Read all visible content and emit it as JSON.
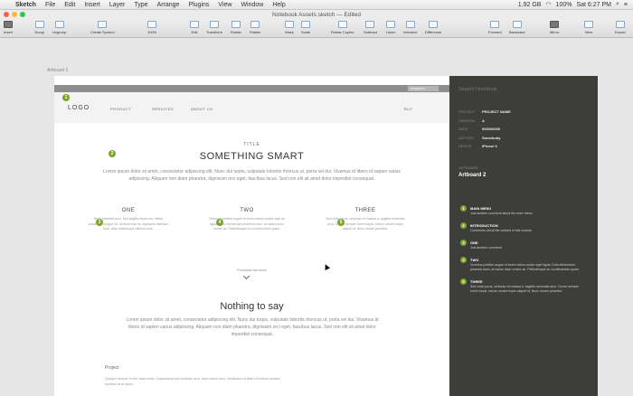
{
  "menubar": {
    "app": "Sketch",
    "items": [
      "File",
      "Edit",
      "Insert",
      "Layer",
      "Type",
      "Arrange",
      "Plugins",
      "View",
      "Window",
      "Help"
    ],
    "disk": "1.92 GB",
    "battery": "100%",
    "clock": "Sat 6:27 PM"
  },
  "window": {
    "title": "Notebook Assets.sketch — Edited"
  },
  "toolbar": {
    "insert": "Insert",
    "group": "Group",
    "ungroup": "Ungroup",
    "create_symbol": "Create Symbol",
    "zoom": "100%",
    "edit": "Edit",
    "transform": "Transform",
    "rotate": "Rotate",
    "flatten": "Flatten",
    "mask": "Mask",
    "scale": "Scale",
    "rotate_copies": "Rotate Copies",
    "subtract": "Subtract",
    "union": "Union",
    "intersect": "Intersect",
    "difference": "Difference",
    "forward": "Forward",
    "backward": "Backward",
    "mirror": "Mirror",
    "view": "View",
    "export": "Export"
  },
  "canvas": {
    "artboard_label": "Artboard 2"
  },
  "artboard": {
    "lang": "english ▾",
    "logo": "LOGO",
    "nav": [
      "PRODUCT",
      "SERVICES",
      "ABOUT US"
    ],
    "buy": "BUY",
    "small_title": "TITLE",
    "hero": "SOMETHING SMART",
    "hero_text": "Lorem ipsum dolor sit amet, consectetur adipiscing elit. Nunc dui turpis, vulputate lobortis rhoncus ut, porta vel dui. Vivamus id libero id sapien varius adipiscing. Aliquam non diam pharetra, dignissim orci eget, faucibus lacus. Sed non elit sit amet dolor imperdiet consequat.",
    "columns": [
      {
        "title": "ONE",
        "text": "Nulla pharetra arcu. Sed sagittis lectus eu, metus solicitudin congue sit. Aenean erat mi, dignissim interdum fiyal, vitae scelerisque efficitur eros."
      },
      {
        "title": "TWO",
        "text": "Vivamus porttitor augue et lorem varius auctor eget ac ligula. Duis elementum pharetra dolor, at varius dolor ornare ac. Pellentesque eu condimentum quam."
      },
      {
        "title": "THREE",
        "text": "Sed nulla purus, vehicula vel massa a, sagittis venenatis arcu. Donec semper lorem turpis, rutrum ornare turpis aliquet id. Nunc ornare pharetra."
      }
    ],
    "more": "Products/ services",
    "h2": "Nothing to say",
    "text2": "Lorem ipsum dolor sit amet, consectetur adipiscing elit. Nunc dui turpis, vulputate lobortis rhoncus ut, porta vel dui. Vivamus id libero id sapien varius adipiscing. Aliquam non diam pharetra, dignissim orci eget, faucibus lacus. Sed non elit sit amet dolor imperdiet consequat.",
    "project_title": "Project",
    "project_text": "Quisque semper ex the vitae mollis. Suspendisse sed molestie arcu, vitae rutrum arcu. Vestibulum at libero et finibus sodales faucibus et at luctus."
  },
  "panel": {
    "search": "Search Notebook",
    "meta": [
      {
        "k": "PROJECT",
        "v": "PROJECT NAME"
      },
      {
        "k": "VERSION",
        "v": "A"
      },
      {
        "k": "DATE",
        "v": "00/00/0000"
      },
      {
        "k": "AUTHOR",
        "v": "Somebody"
      },
      {
        "k": "DEVICE",
        "v": "iPhone 6"
      }
    ],
    "artboard_label": "ARTBOARD",
    "artboard_name": "Artboard 2",
    "notes": [
      {
        "n": "1",
        "title": "MAIN MENU",
        "desc": "Just another comment about the main menu."
      },
      {
        "n": "2",
        "title": "INTRODUCTION",
        "desc": "Comments about the content of this module."
      },
      {
        "n": "3",
        "title": "ONE",
        "desc": "Just another comment."
      },
      {
        "n": "4",
        "title": "TWO",
        "desc": "Vivamus porttitor augue et lorem varius auctor eget ligula. Duis elementum pharetra dolor, at varius dolor ornare ac. Pellentesque eu condimentum quam."
      },
      {
        "n": "5",
        "title": "THREE",
        "desc": "Sed nulla purus, vehicula vel massa a, sagittis venenatis arcu. Donec semper lorem turpis, rutrum ornare turpis aliquet id. Nunc ornare pharetra."
      }
    ]
  }
}
